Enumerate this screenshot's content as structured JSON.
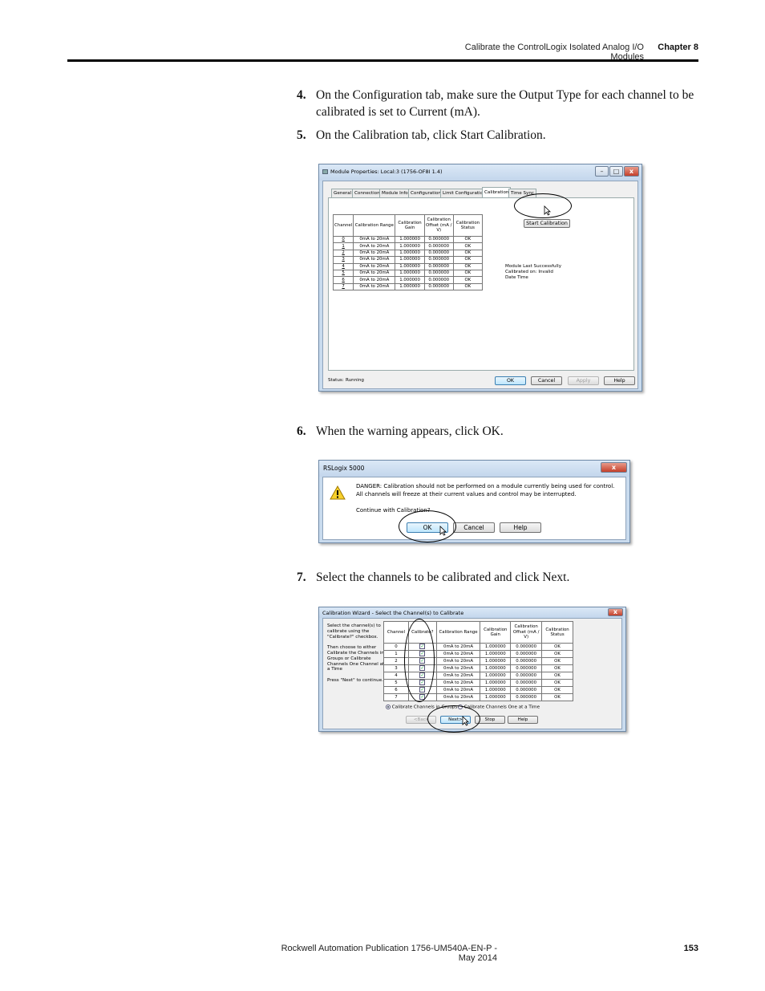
{
  "header": {
    "section_title": "Calibrate the ControlLogix Isolated Analog I/O Modules",
    "chapter": "Chapter 8"
  },
  "footer": {
    "publication": "Rockwell Automation Publication 1756-UM540A-EN-P - May 2014",
    "page_number": "153"
  },
  "steps": [
    {
      "num": "4.",
      "text": "On the Configuration tab, make sure the Output Type for each channel to be calibrated is set to Current (mA)."
    },
    {
      "num": "5.",
      "text": "On the Calibration tab, click Start Calibration."
    },
    {
      "num": "6.",
      "text": "When the warning appears, click OK."
    },
    {
      "num": "7.",
      "text": "Select the channels to be calibrated and click Next."
    }
  ],
  "module_dialog": {
    "title": "Module Properties: Local:3 (1756-OF8I 1.4)",
    "tabs": [
      "General",
      "Connection",
      "Module Info",
      "Configuration",
      "Limit Configuration",
      "Calibration",
      "Time Sync"
    ],
    "active_tab": "Calibration",
    "columns": [
      "Channel",
      "Calibration Range",
      "Calibration Gain",
      "Calibration Offset (mA / V)",
      "Calibration Status"
    ],
    "rows": [
      [
        "0",
        "0mA to 20mA",
        "1.000000",
        "0.000000",
        "OK"
      ],
      [
        "1",
        "0mA to 20mA",
        "1.000000",
        "0.000000",
        "OK"
      ],
      [
        "2",
        "0mA to 20mA",
        "1.000000",
        "0.000000",
        "OK"
      ],
      [
        "3",
        "0mA to 20mA",
        "1.000000",
        "0.000000",
        "OK"
      ],
      [
        "4",
        "0mA to 20mA",
        "1.000000",
        "0.000000",
        "OK"
      ],
      [
        "5",
        "0mA to 20mA",
        "1.000000",
        "0.000000",
        "OK"
      ],
      [
        "6",
        "0mA to 20mA",
        "1.000000",
        "0.000000",
        "OK"
      ],
      [
        "7",
        "0mA to 20mA",
        "1.000000",
        "0.000000",
        "OK"
      ]
    ],
    "start_button": "Start Calibration",
    "last_cal_line1": "Module Last Successfully",
    "last_cal_line2": "Calibrated on:  Invalid",
    "last_cal_line3": "Date Time",
    "status_label": "Status:",
    "status_value": "Running",
    "buttons": {
      "ok": "OK",
      "cancel": "Cancel",
      "apply": "Apply",
      "help": "Help"
    }
  },
  "warning_dialog": {
    "title": "RSLogix 5000",
    "line1": "DANGER: Calibration should not be performed on a module currently being used for control.",
    "line2": "All channels will freeze at their current values and control may be interrupted.",
    "line3": "Continue with Calibration?",
    "buttons": {
      "ok": "OK",
      "cancel": "Cancel",
      "help": "Help"
    }
  },
  "wizard_dialog": {
    "title": "Calibration Wizard - Select the Channel(s) to Calibrate",
    "instructions": [
      "Select the channel(s) to",
      "calibrate using the",
      "\"Calibrate?\" checkbox.",
      "",
      "Then choose to either",
      "Calibrate the Channels in",
      "Groups or Calibrate",
      "Channels One Channel at",
      "a Time",
      "",
      "Press \"Next\" to continue."
    ],
    "columns": [
      "Channel",
      "Calibrate?",
      "Calibration Range",
      "Calibration Gain",
      "Calibration Offset (mA / V)",
      "Calibration Status"
    ],
    "rows": [
      [
        "0",
        "0mA to 20mA",
        "1.000000",
        "0.000000",
        "OK"
      ],
      [
        "1",
        "0mA to 20mA",
        "1.000000",
        "0.000000",
        "OK"
      ],
      [
        "2",
        "0mA to 20mA",
        "1.000000",
        "0.000000",
        "OK"
      ],
      [
        "3",
        "0mA to 20mA",
        "1.000000",
        "0.000000",
        "OK"
      ],
      [
        "4",
        "0mA to 20mA",
        "1.000000",
        "0.000000",
        "OK"
      ],
      [
        "5",
        "0mA to 20mA",
        "1.000000",
        "0.000000",
        "OK"
      ],
      [
        "6",
        "0mA to 20mA",
        "1.000000",
        "0.000000",
        "OK"
      ],
      [
        "7",
        "0mA to 20mA",
        "1.000000",
        "0.000000",
        "OK"
      ]
    ],
    "check_mark": "✓",
    "radio_groups": "Calibrate Channels in Groups",
    "radio_one": "Calibrate Channels One at a Time",
    "buttons": {
      "back": "<Back",
      "next": "Next>",
      "stop": "Stop",
      "help": "Help"
    }
  },
  "window_controls": {
    "minimize": "–",
    "maximize": "□",
    "close": "x"
  }
}
